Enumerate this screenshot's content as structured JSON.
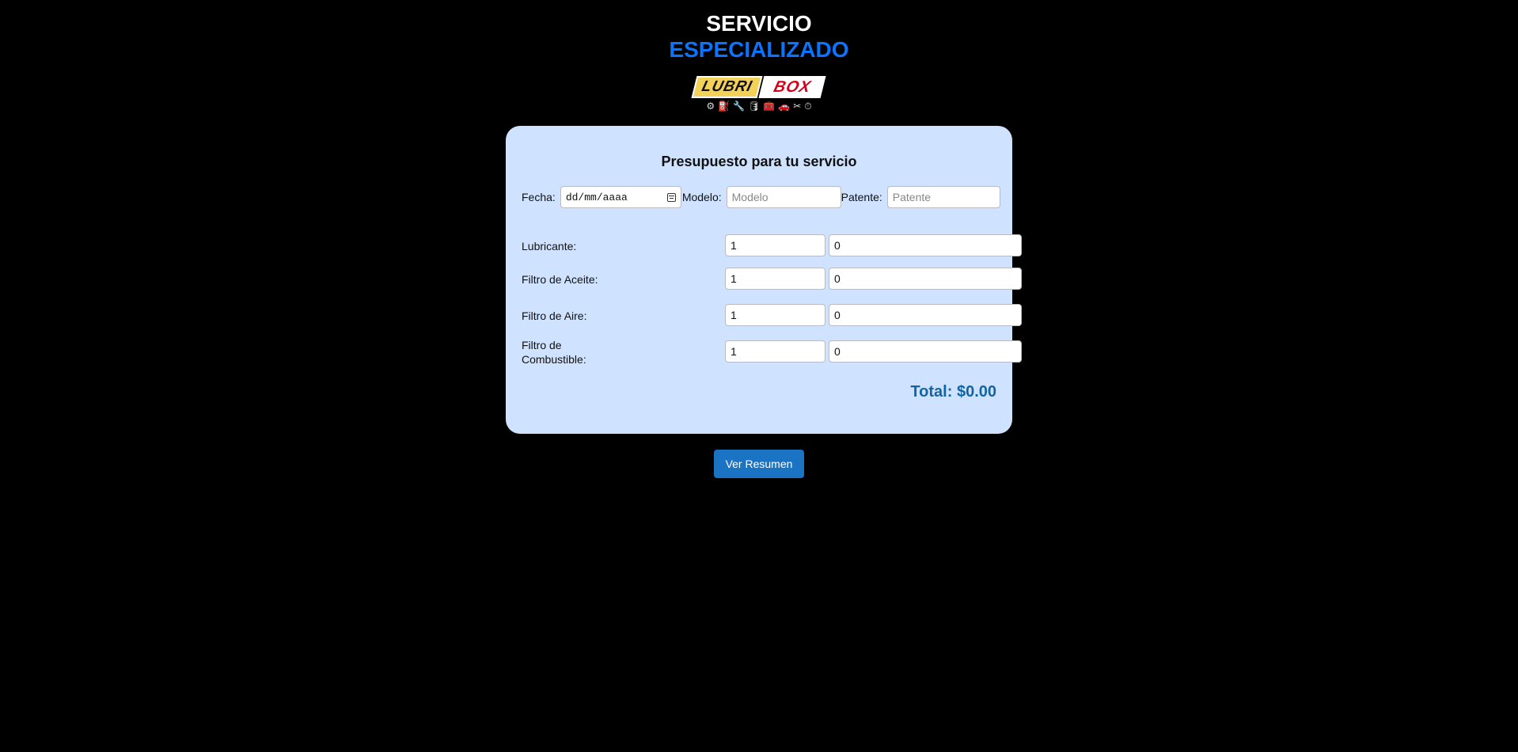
{
  "header": {
    "title_line1": "SERVICIO",
    "title_line2": "ESPECIALIZADO",
    "logo_left": "LUBRI",
    "logo_right": "BOX",
    "logo_icons": [
      "⚙",
      "⛽",
      "🔧",
      "🛢",
      "🧰",
      "🚗",
      "✂",
      "⏱"
    ]
  },
  "form": {
    "title": "Presupuesto para tu servicio",
    "fecha_label": "Fecha:",
    "fecha_placeholder": "dd/mm/aaaa",
    "modelo_label": "Modelo:",
    "modelo_placeholder": "Modelo",
    "patente_label": "Patente:",
    "patente_placeholder": "Patente",
    "items": [
      {
        "label": "Lubricante:",
        "qty": "1",
        "price": "0"
      },
      {
        "label": "Filtro de Aceite:",
        "qty": "1",
        "price": "0"
      },
      {
        "label": "Filtro de Aire:",
        "qty": "1",
        "price": "0"
      },
      {
        "label": "Filtro de Combustible:",
        "qty": "1",
        "price": "0"
      }
    ],
    "total": "Total: $0.00"
  },
  "actions": {
    "ver_resumen": "Ver Resumen"
  },
  "colors": {
    "background": "#000000",
    "card": "#cfe2ff",
    "accent": "#0a74ff",
    "button": "#1a73c3",
    "total": "#1264a3"
  }
}
